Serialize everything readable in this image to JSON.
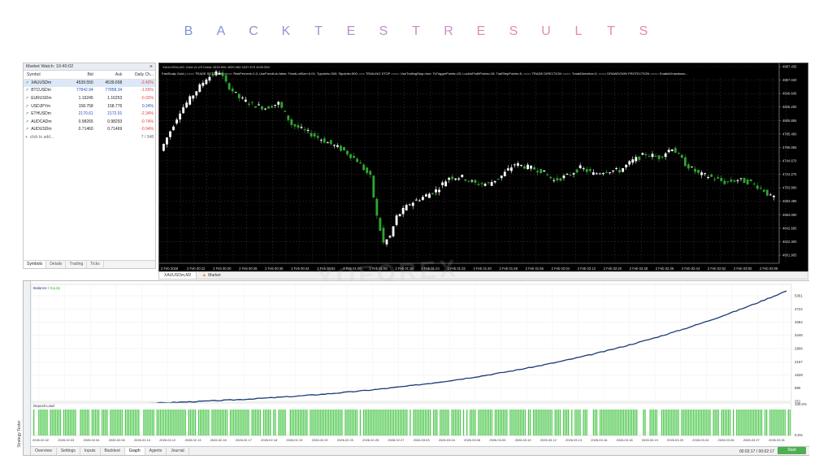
{
  "header": {
    "title_letters": [
      "B",
      "A",
      "C",
      "K",
      "T",
      "E",
      "S",
      "T",
      "R",
      "E",
      "S",
      "U",
      "L",
      "T",
      "S"
    ],
    "colors": [
      "#7b93cf",
      "#8594d0",
      "#8e94cf",
      "#9a93cf",
      "#a592ce",
      "#b191cc",
      "#bc90ca",
      "#c78fc6",
      "#d18ec2",
      "#da8dbd",
      "#e08cb8",
      "#e58bb2",
      "#e78aad",
      "#e988a8",
      "#ea87a2"
    ]
  },
  "market_watch": {
    "title": "Market Watch: 10:40:02",
    "close": "×",
    "columns": [
      "Symbol",
      "Bid",
      "Ask",
      "Daily Ch..."
    ],
    "rows": [
      {
        "symbol": "XAUUSDm",
        "bid": "4539.550",
        "ask": "4539.658",
        "change": "-2.42%",
        "dir": "neg",
        "price_class": "",
        "selected": true
      },
      {
        "symbol": "BTCUSDm",
        "bid": "77842.94",
        "ask": "77858.34",
        "change": "-1.55%",
        "dir": "neg",
        "price_class": "blue",
        "selected": false
      },
      {
        "symbol": "EURUSDm",
        "bid": "1.16245",
        "ask": "1.16253",
        "change": "-0.32%",
        "dir": "neg",
        "price_class": "",
        "selected": false
      },
      {
        "symbol": "USDJPYm",
        "bid": "158.758",
        "ask": "158.776",
        "change": "0.24%",
        "dir": "pos",
        "price_class": "",
        "selected": false
      },
      {
        "symbol": "ETHUSDm",
        "bid": "2170.61",
        "ask": "2172.01",
        "change": "-2.34%",
        "dir": "neg",
        "price_class": "blue",
        "selected": false
      },
      {
        "symbol": "AUDCADm",
        "bid": "0.98265",
        "ask": "0.98293",
        "change": "-0.74%",
        "dir": "neg",
        "price_class": "",
        "selected": false
      },
      {
        "symbol": "AUDUSDm",
        "bid": "0.71460",
        "ask": "0.71469",
        "change": "-0.94%",
        "dir": "neg",
        "price_class": "",
        "selected": false
      }
    ],
    "add_label": "click to add...",
    "count": "7 / 348",
    "tabs": [
      "Symbols",
      "Details",
      "Trading",
      "Ticks"
    ]
  },
  "chart": {
    "info": "XAUUSDm,M2: Gold vs US Dollar  4539.806  4539.983  4537.876  4539.550",
    "params": "FastScalp Gold | ==== TRADE SETTINGS ====: RiskPercent=1.0; UseFixedLot=false; FixedLotSize=0.01; Tppoints=300; Slpoints=500; === TRAILING STOP ====: UseTrailingStop=true; TsTriggerPoints=20; LockInProfitPoints=15; TrailStepPoints=5; ==== TRADE DIRECTION ====: TradeDirection=2; ==== DRAWDOWN PROTECTION ====: EnableDrawdown...",
    "price_labels": [
      "4887.435",
      "4867.040",
      "4846.645",
      "4826.250",
      "4805.855",
      "4785.460",
      "4765.065",
      "4744.670",
      "4724.275",
      "4703.880",
      "4683.485",
      "4663.090",
      "4642.695",
      "4622.300",
      "4601.905"
    ],
    "time_labels": [
      "2 Feb 2026",
      "2 Feb 00:12",
      "2 Feb 00:20",
      "2 Feb 00:28",
      "2 Feb 00:36",
      "2 Feb 00:44",
      "2 Feb 00:52",
      "2 Feb 01:00",
      "2 Feb 01:08",
      "2 Feb 01:16",
      "2 Feb 01:24",
      "2 Feb 01:32",
      "2 Feb 01:40",
      "2 Feb 01:48",
      "2 Feb 01:56",
      "2 Feb 02:04",
      "2 Feb 02:12",
      "2 Feb 02:20",
      "2 Feb 02:28",
      "2 Feb 02:36",
      "2 Feb 02:44",
      "2 Feb 02:52",
      "2 Feb 03:00",
      "2 Feb 03:08"
    ],
    "tabs": [
      "XAUUSDm,M2",
      "Market"
    ],
    "colors": {
      "background": "#000000",
      "bull": "#ffffff",
      "bear": "#2fa52f",
      "grid": "#2a2a2a"
    }
  },
  "watermark": {
    "text": "YOFOREX"
  },
  "tester": {
    "side_label": "Strategy Tester",
    "legend_balance": "Balance",
    "legend_sep": " / ",
    "legend_equity": "Equity",
    "y_labels": [
      "5361",
      "4722",
      "4084",
      "3446",
      "2806",
      "2167",
      "1528",
      "890",
      "251"
    ],
    "deposit_label": "Deposit Load",
    "load_labels": [
      "100.0%",
      "0.0%"
    ],
    "dates": [
      "2026.02.02",
      "2026.02.03",
      "2026.02.04",
      "2026.02.06",
      "2026.02.10",
      "2026.02.12",
      "2026.02.13",
      "2026.02.16",
      "2026.02.17",
      "2026.02.18",
      "2026.02.19",
      "2026.02.20",
      "2026.02.23",
      "2026.02.25",
      "2026.02.27",
      "2026.03.03",
      "2026.03.04",
      "2026.03.06",
      "2026.03.09",
      "2026.03.10",
      "2026.03.12",
      "2026.03.13",
      "2026.03.16",
      "2026.03.18",
      "2026.03.19",
      "2026.03.20",
      "2026.03.24",
      "2026.03.26",
      "2026.03.27",
      "2026.03.31"
    ],
    "tabs": [
      "Overview",
      "Settings",
      "Inputs",
      "Backtest",
      "Graph",
      "Agents",
      "Journal"
    ],
    "active_tab": "Graph",
    "time": "00:02:17 / 00:02:17",
    "start_label": "Start"
  }
}
